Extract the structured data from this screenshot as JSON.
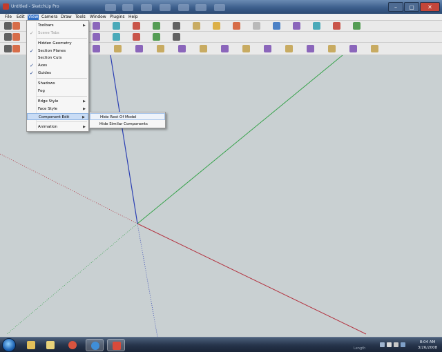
{
  "window": {
    "title": "Untitled - SketchUp Pro",
    "minimize": "–",
    "maximize": "▢",
    "close": "✕"
  },
  "menubar": [
    {
      "label": "File"
    },
    {
      "label": "Edit"
    },
    {
      "label": "View",
      "active": true
    },
    {
      "label": "Camera"
    },
    {
      "label": "Draw"
    },
    {
      "label": "Tools"
    },
    {
      "label": "Window"
    },
    {
      "label": "Plugins"
    },
    {
      "label": "Help"
    }
  ],
  "view_menu": [
    {
      "label": "Toolbars",
      "submenu": true
    },
    {
      "label": "Scene Tabs",
      "checked": true,
      "disabled": true
    },
    {
      "separator": true
    },
    {
      "label": "Hidden Geometry"
    },
    {
      "label": "Section Planes",
      "checked": true
    },
    {
      "label": "Section Cuts"
    },
    {
      "label": "Axes",
      "checked": true
    },
    {
      "label": "Guides",
      "checked": true
    },
    {
      "separator": true
    },
    {
      "label": "Shadows"
    },
    {
      "label": "Fog"
    },
    {
      "separator": true
    },
    {
      "label": "Edge Style",
      "submenu": true
    },
    {
      "label": "Face Style",
      "submenu": true
    },
    {
      "label": "Component Edit",
      "submenu": true,
      "highlighted": true
    },
    {
      "separator": true
    },
    {
      "label": "Animation",
      "submenu": true
    }
  ],
  "component_edit_submenu": [
    {
      "label": "Hide Rest Of Model",
      "highlighted": true
    },
    {
      "label": "Hide Similar Components"
    }
  ],
  "taskbar": {
    "time": "8:04 AM",
    "date": "3/26/2008",
    "faint_label": "Length"
  },
  "colors": {
    "viewport": "#c9d0d2",
    "axis_red": "#b3323f",
    "axis_green": "#35a24a",
    "axis_blue": "#2b3fb3",
    "menu_highlight": "#c9dcf5"
  },
  "icons": {
    "start": "windows-start-icon",
    "explorer": "folder-icon",
    "media": "media-player-icon",
    "chrome": "browser-icon",
    "ie": "internet-explorer-icon",
    "sketchup": "sketchup-icon"
  }
}
